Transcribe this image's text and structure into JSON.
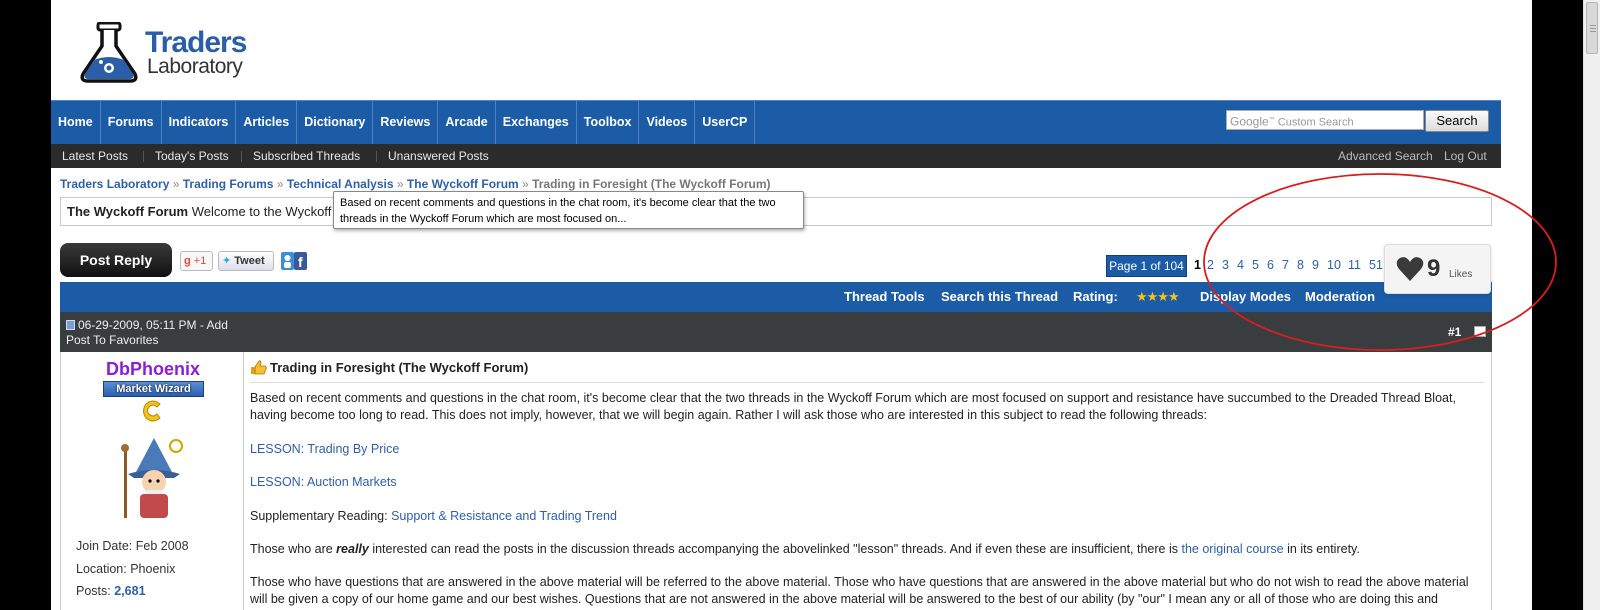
{
  "logo": {
    "line1": "Traders",
    "line2": "Laboratory"
  },
  "nav": [
    "Home",
    "Forums",
    "Indicators",
    "Articles",
    "Dictionary",
    "Reviews",
    "Arcade",
    "Exchanges",
    "Toolbox",
    "Videos",
    "UserCP"
  ],
  "search": {
    "placeholder": "Custom Search",
    "google": "Google",
    "button": "Search"
  },
  "subnav": {
    "left": [
      "Latest Posts",
      "Today's Posts",
      "Subscribed Threads",
      "Unanswered Posts"
    ],
    "right": [
      "Advanced Search",
      "Log Out"
    ]
  },
  "breadcrumb": {
    "items": [
      "Traders Laboratory",
      "Trading Forums",
      "Technical Analysis",
      "The Wyckoff Forum"
    ],
    "sep": "»",
    "current": "Trading in Foresight (The Wyckoff Forum)"
  },
  "forumbar": {
    "name": "The Wyckoff Forum",
    "text": "Welcome to the Wyckoff"
  },
  "tooltip": "Based on recent comments and questions in the chat room, it's become clear that the two threads in the Wyckoff Forum which are most focused on...",
  "post_reply": "Post Reply",
  "social": {
    "gplus": "+1",
    "tweet": "Tweet"
  },
  "pagination": {
    "label": "Page 1 of 104",
    "pages": [
      "1",
      "2",
      "3",
      "4",
      "5",
      "6",
      "7",
      "8",
      "9",
      "10",
      "11",
      "51"
    ],
    "active": "1"
  },
  "likes": {
    "count": "9",
    "label": "Likes"
  },
  "toolbar": {
    "thread_tools": "Thread Tools",
    "search_thread": "Search this Thread",
    "rating": "Rating:",
    "stars": "★★★★",
    "display_modes": "Display Modes",
    "moderation": "Moderation"
  },
  "post": {
    "date": "06-29-2009, 05:11 PM - Add",
    "favorites": "Post To Favorites",
    "number": "#1",
    "user": {
      "name": "DbPhoenix",
      "rank": "Market Wizard",
      "join": "Join Date: Feb 2008",
      "location": "Location: Phoenix",
      "posts_label": "Posts:",
      "posts": "2,681"
    },
    "title": "Trading in Foresight (The Wyckoff Forum)",
    "p1": "Based on recent comments and questions in the chat room, it's become clear that the two threads in the Wyckoff Forum which are most focused on support and resistance have succumbed to the Dreaded Thread Bloat, having become too long to read. This does not imply, however, that we will begin again. Rather I will ask those who are interested in this subject to read the following threads:",
    "link1": "LESSON: Trading By Price",
    "link2": "LESSON: Auction Markets",
    "supp_label": "Supplementary Reading:",
    "supp_link": "Support & Resistance and Trading Trend",
    "p4_a": "Those who are",
    "p4_em": "really",
    "p4_b": "interested can read the posts in the discussion threads accompanying the abovelinked \"lesson\" threads. And if even these are insufficient, there is",
    "p4_link": "the original course",
    "p4_c": "in its entirety.",
    "p5": "Those who have questions that are answered in the above material will be referred to the above material. Those who have questions that are answered in the above material but who do not wish to read the above material will be given a copy of our home game and our best wishes. Questions that are not answered in the above material will be answered to the best of our ability (by \"our\" I mean any or all of those who are doing this and"
  },
  "colors": {
    "nav_blue": "#1c5ca6",
    "subnav": "#2b2b2b",
    "post_header": "#393d40",
    "link": "#2e5fa8",
    "username": "#8b1fd6",
    "annotation": "#d81e1e"
  }
}
